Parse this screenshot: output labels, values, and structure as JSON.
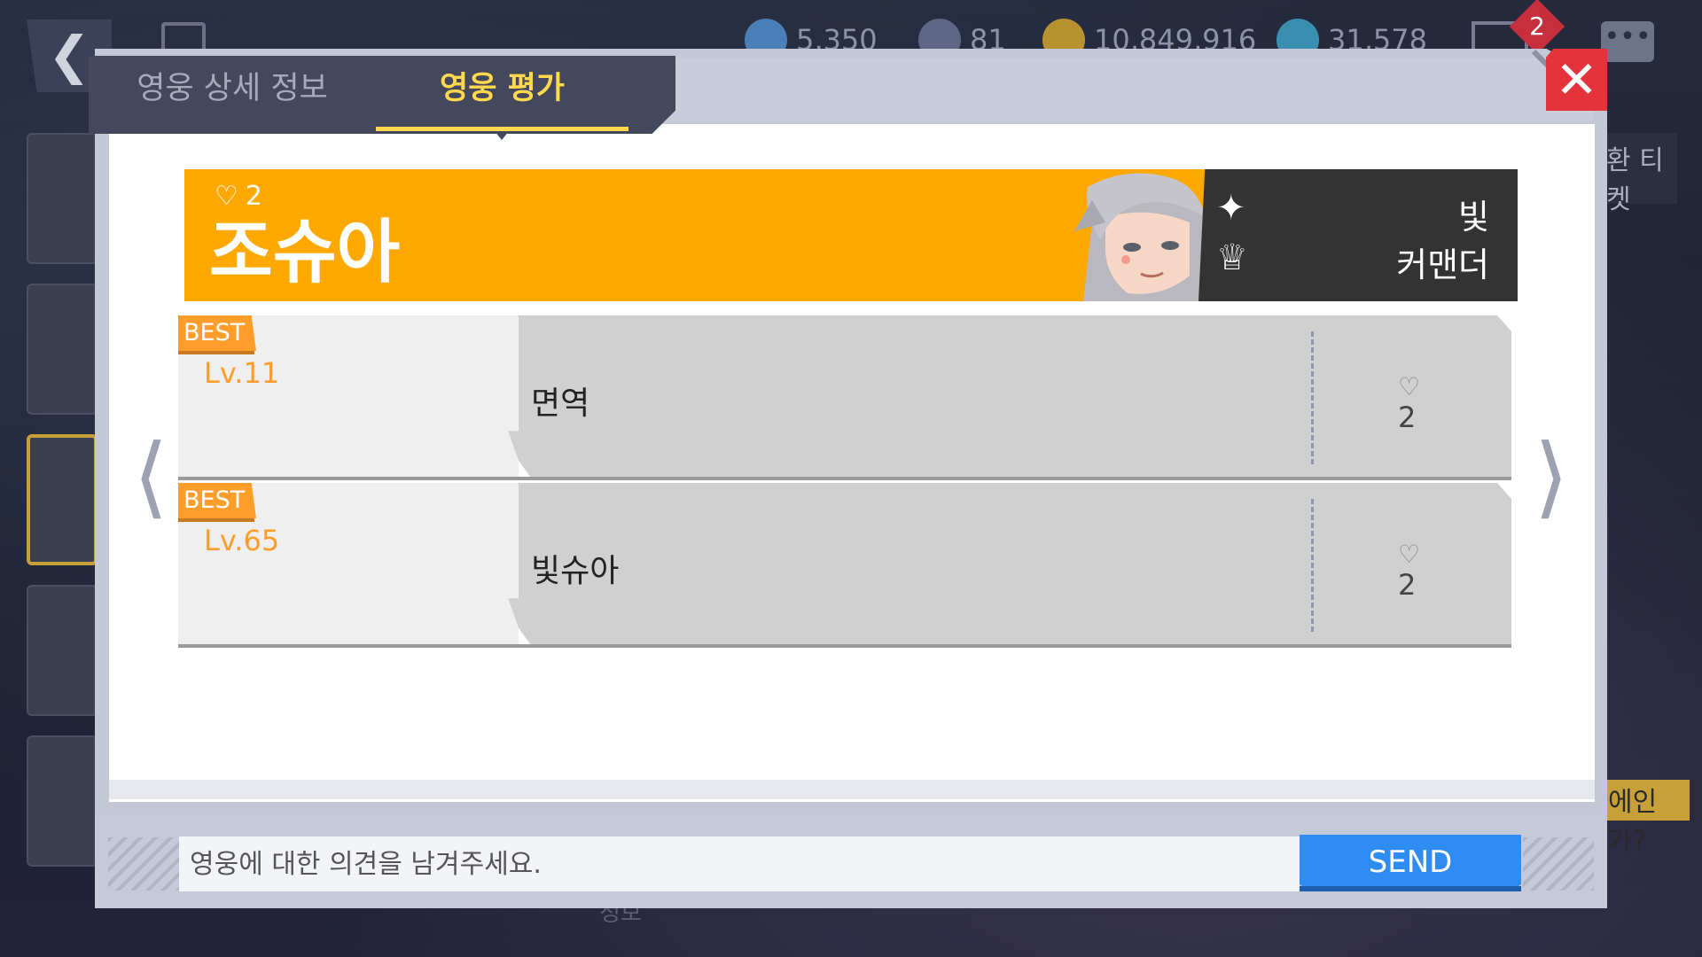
{
  "topbar": {
    "currencies": [
      {
        "name": "crystal-currency",
        "value": "5,350",
        "color": "#4a7fb8"
      },
      {
        "name": "stamina-currency",
        "value": "81",
        "color": "#5d6684"
      },
      {
        "name": "gold-currency",
        "value": "10,849,916",
        "color": "#b8922e"
      },
      {
        "name": "gem-currency",
        "value": "31,578",
        "color": "#3a8fb0"
      }
    ],
    "mail_count": "2"
  },
  "background": {
    "ticket_text": "환 티켓",
    "question_text": "에인가?",
    "bottom_text": "정보"
  },
  "tabs": {
    "detail": "영웅 상세 정보",
    "evaluation": "영웅 평가"
  },
  "hero": {
    "likes": "2",
    "name": "조슈아",
    "attribute": "빛",
    "class": "커맨더"
  },
  "comments": [
    {
      "badge": "BEST",
      "level": "Lv.11",
      "text": "면역",
      "likes": "2"
    },
    {
      "badge": "BEST",
      "level": "Lv.65",
      "text": "빛슈아",
      "likes": "2"
    }
  ],
  "input": {
    "placeholder": "영웅에 대한 의견을 남겨주세요.",
    "send_label": "SEND"
  },
  "colors": {
    "accent_orange": "#ffa800",
    "best_orange": "#ff9d2b",
    "send_blue": "#2f8cf2",
    "close_red": "#e4333a",
    "tab_yellow": "#ffd84d"
  }
}
